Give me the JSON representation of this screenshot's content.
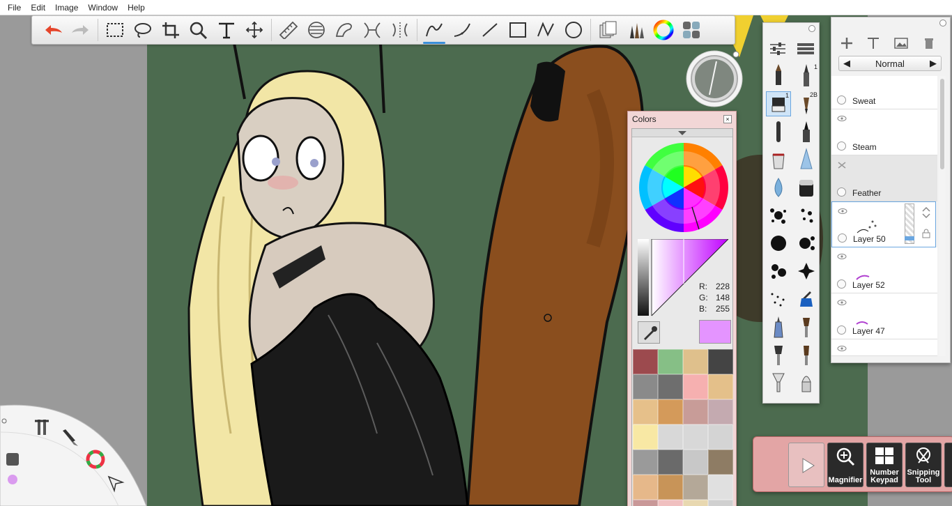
{
  "menu": [
    "File",
    "Edit",
    "Image",
    "Window",
    "Help"
  ],
  "toolbar": {
    "tools": [
      "undo-icon",
      "redo-icon",
      "rect-select-icon",
      "lasso-icon",
      "crop-icon",
      "magnifier-icon",
      "text-icon",
      "move-icon",
      "ruler-icon",
      "ellipse-guide-icon",
      "french-curve-icon",
      "symmetry-icon",
      "symmetry-y-icon",
      "freehand-icon",
      "curve-icon",
      "line-icon",
      "rectangle-icon",
      "polyline-icon",
      "circle-icon",
      "layers-icon",
      "brushes-icon",
      "color-wheel-icon",
      "palette-grid-icon"
    ],
    "selected": "freehand-icon"
  },
  "colors_panel": {
    "title": "Colors",
    "r_label": "R:",
    "r_value": "228",
    "g_label": "G:",
    "g_value": "148",
    "b_label": "B:",
    "b_value": "255",
    "current_color": "#e494ff",
    "swatches": [
      "#9c4a4e",
      "#86bf86",
      "#dfc08c",
      "#444444",
      "#8a8a8a",
      "#6e6e6e",
      "#f6b0b0",
      "#e4c08a",
      "#e6c08a",
      "#d49a5a",
      "#c89c98",
      "#c4aab0",
      "#f8e8a4",
      "#d8d8d8",
      "#d8d8d8",
      "#d4d4d4",
      "#9a9a9a",
      "#6a6a6a",
      "#c8c8c8",
      "#8e7c64",
      "#e6b88a",
      "#c89458",
      "#b4a898",
      "#e0e0e0",
      "#c99898",
      "#f0c0c0",
      "#e8d8b0",
      "#d0d0d0"
    ]
  },
  "brushes": {
    "numbers": {
      "one_a": "1",
      "one_b": "1",
      "two_b": "2B"
    }
  },
  "layers": {
    "blend_mode": "Normal",
    "items": [
      {
        "name": "Sweat"
      },
      {
        "name": "Steam"
      },
      {
        "name": "Feather"
      },
      {
        "name": "Layer 50"
      },
      {
        "name": "Layer 52"
      },
      {
        "name": "Layer 47"
      }
    ]
  },
  "tray": {
    "magnifier": "Magnifier",
    "keypad_line1": "Number",
    "keypad_line2": "Keypad",
    "snip_line1": "Snipping",
    "snip_line2": "Tool"
  }
}
